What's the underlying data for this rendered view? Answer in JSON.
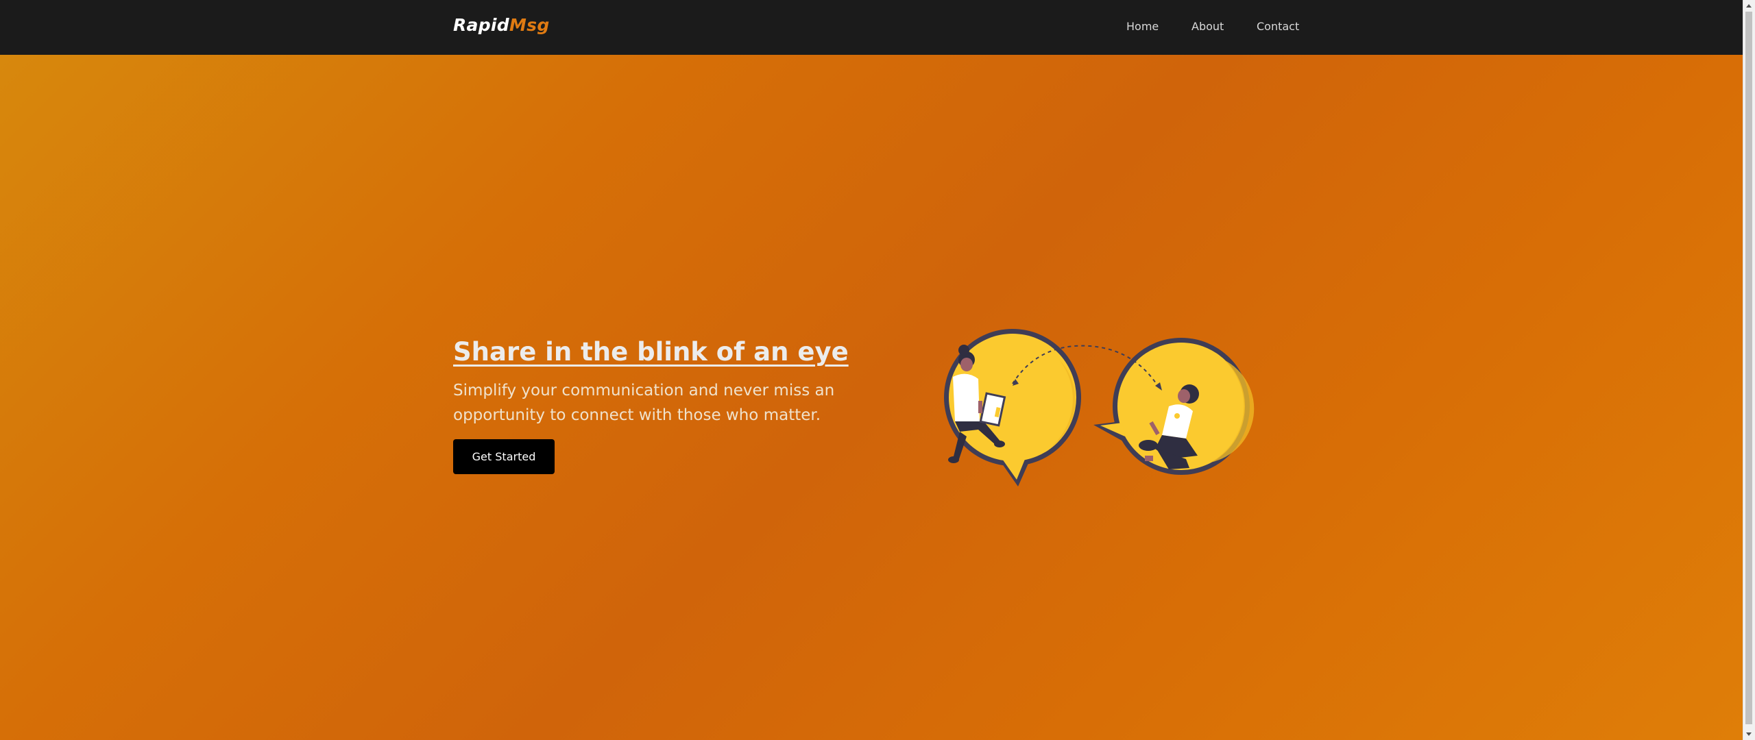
{
  "brand": {
    "part1": "Rapid",
    "part2": "Msg"
  },
  "nav": {
    "home": "Home",
    "about": "About",
    "contact": "Contact"
  },
  "hero": {
    "title": "Share in the blink of an eye",
    "subtitle": "Simplify your communication and never miss an opportunity to connect with those who matter.",
    "cta_label": "Get Started"
  },
  "colors": {
    "navbar": "#1b1b1b",
    "accent": "#e07b12",
    "hero_gradient": "#d66f07",
    "bubble_yellow": "#fbca2f",
    "button": "#000000"
  },
  "illustration": {
    "icons": [
      "chat-bubble-left-icon",
      "chat-bubble-right-icon",
      "person-with-laptop-icon",
      "person-with-phone-icon"
    ]
  }
}
